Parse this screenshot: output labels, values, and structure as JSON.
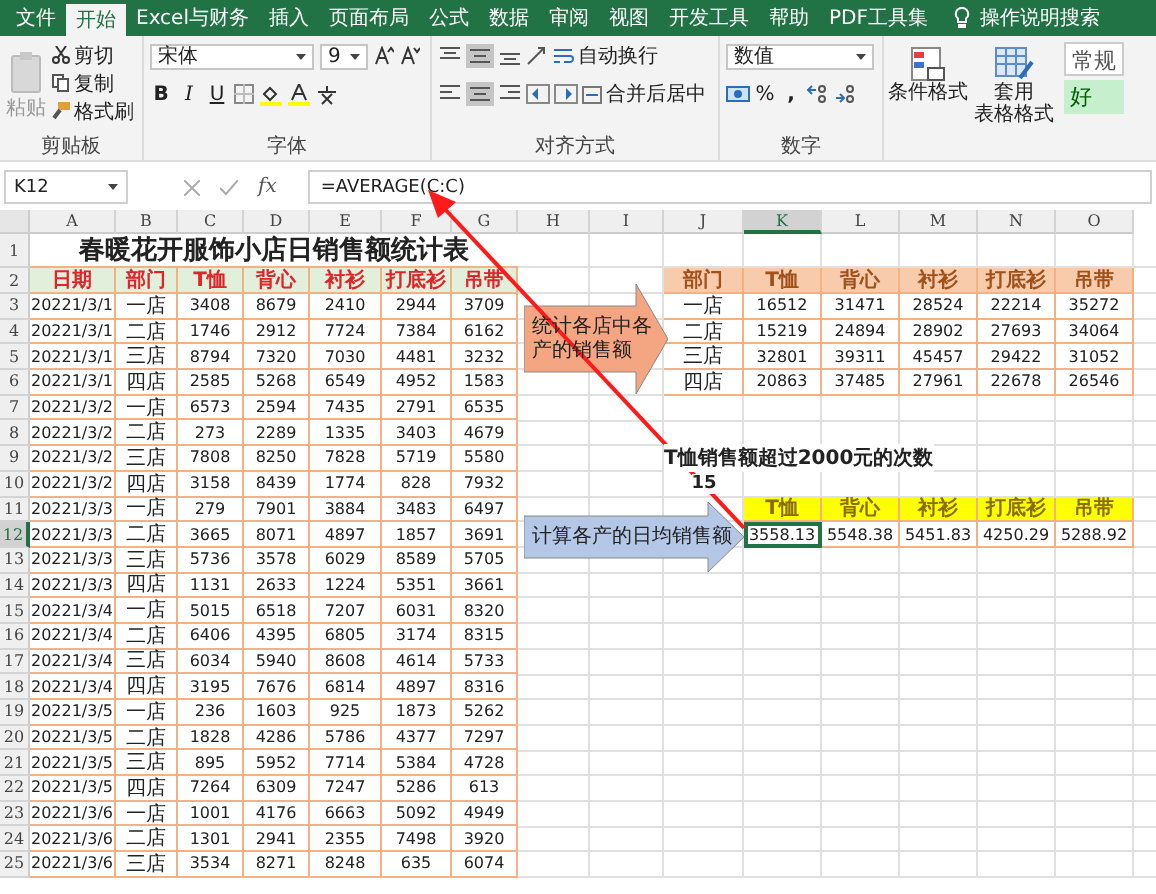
{
  "tabs": [
    {
      "label": "文件",
      "selected": false
    },
    {
      "label": "开始",
      "selected": true
    },
    {
      "label": "Excel与财务",
      "selected": false
    },
    {
      "label": "插入",
      "selected": false
    },
    {
      "label": "页面布局",
      "selected": false
    },
    {
      "label": "公式",
      "selected": false
    },
    {
      "label": "数据",
      "selected": false
    },
    {
      "label": "审阅",
      "selected": false
    },
    {
      "label": "视图",
      "selected": false
    },
    {
      "label": "开发工具",
      "selected": false
    },
    {
      "label": "帮助",
      "selected": false
    },
    {
      "label": "PDF工具集",
      "selected": false
    }
  ],
  "search": {
    "placeholder": "操作说明搜索"
  },
  "ribbon": {
    "clipboard": {
      "label": "剪贴板",
      "paste": "粘贴",
      "cut": "剪切",
      "copy": "复制",
      "format_painter": "格式刷"
    },
    "font": {
      "label": "字体",
      "font_name": "宋体",
      "font_size": "9",
      "bold": "B",
      "italic": "I",
      "underline": "U"
    },
    "alignment": {
      "label": "对齐方式",
      "wrap_text": "自动换行",
      "merge_center": "合并后居中"
    },
    "number": {
      "label": "数字",
      "format": "数值",
      "percent": "%",
      "comma": ","
    },
    "styles": {
      "conditional_format": "条件格式",
      "table_format_1": "套用",
      "table_format_2": "表格格式",
      "style_normal": "常规",
      "style_good": "好"
    }
  },
  "formula_bar": {
    "name_box": "K12",
    "fx": "fx",
    "formula": "=AVERAGE(C:C)"
  },
  "sheet": {
    "columns": [
      {
        "label": "A",
        "selected": false
      },
      {
        "label": "B",
        "selected": false
      },
      {
        "label": "C",
        "selected": false
      },
      {
        "label": "D",
        "selected": false
      },
      {
        "label": "E",
        "selected": false
      },
      {
        "label": "F",
        "selected": false
      },
      {
        "label": "G",
        "selected": false
      },
      {
        "label": "H",
        "selected": false
      },
      {
        "label": "I",
        "selected": false
      },
      {
        "label": "J",
        "selected": false
      },
      {
        "label": "K",
        "selected": true
      },
      {
        "label": "L",
        "selected": false
      },
      {
        "label": "M",
        "selected": false
      },
      {
        "label": "N",
        "selected": false
      },
      {
        "label": "O",
        "selected": false
      }
    ],
    "rows": [
      {
        "label": "1",
        "selected": false
      },
      {
        "label": "2",
        "selected": false
      },
      {
        "label": "3",
        "selected": false
      },
      {
        "label": "4",
        "selected": false
      },
      {
        "label": "5",
        "selected": false
      },
      {
        "label": "6",
        "selected": false
      },
      {
        "label": "7",
        "selected": false
      },
      {
        "label": "8",
        "selected": false
      },
      {
        "label": "9",
        "selected": false
      },
      {
        "label": "10",
        "selected": false
      },
      {
        "label": "11",
        "selected": false
      },
      {
        "label": "12",
        "selected": true
      },
      {
        "label": "13",
        "selected": false
      },
      {
        "label": "14",
        "selected": false
      },
      {
        "label": "15",
        "selected": false
      },
      {
        "label": "16",
        "selected": false
      },
      {
        "label": "17",
        "selected": false
      },
      {
        "label": "18",
        "selected": false
      },
      {
        "label": "19",
        "selected": false
      },
      {
        "label": "20",
        "selected": false
      },
      {
        "label": "21",
        "selected": false
      },
      {
        "label": "22",
        "selected": false
      },
      {
        "label": "23",
        "selected": false
      },
      {
        "label": "24",
        "selected": false
      },
      {
        "label": "25",
        "selected": false
      }
    ]
  },
  "sales": {
    "title": "春暖花开服饰小店日销售额统计表",
    "headers": [
      "日期",
      "部门",
      "T恤",
      "背心",
      "衬衫",
      "打底衫",
      "吊带"
    ],
    "rows": [
      [
        "20221/3/1",
        "一店",
        "3408",
        "8679",
        "2410",
        "2944",
        "3709"
      ],
      [
        "20221/3/1",
        "二店",
        "1746",
        "2912",
        "7724",
        "7384",
        "6162"
      ],
      [
        "20221/3/1",
        "三店",
        "8794",
        "7320",
        "7030",
        "4481",
        "3232"
      ],
      [
        "20221/3/1",
        "四店",
        "2585",
        "5268",
        "6549",
        "4952",
        "1583"
      ],
      [
        "20221/3/2",
        "一店",
        "6573",
        "2594",
        "7435",
        "2791",
        "6535"
      ],
      [
        "20221/3/2",
        "二店",
        "273",
        "2289",
        "1335",
        "3403",
        "4679"
      ],
      [
        "20221/3/2",
        "三店",
        "7808",
        "8250",
        "7828",
        "5719",
        "5580"
      ],
      [
        "20221/3/2",
        "四店",
        "3158",
        "8439",
        "1774",
        "828",
        "7932"
      ],
      [
        "20221/3/3",
        "一店",
        "279",
        "7901",
        "3884",
        "3483",
        "6497"
      ],
      [
        "20221/3/3",
        "二店",
        "3665",
        "8071",
        "4897",
        "1857",
        "3691"
      ],
      [
        "20221/3/3",
        "三店",
        "5736",
        "3578",
        "6029",
        "8589",
        "5705"
      ],
      [
        "20221/3/3",
        "四店",
        "1131",
        "2633",
        "1224",
        "5351",
        "3661"
      ],
      [
        "20221/3/4",
        "一店",
        "5015",
        "6518",
        "7207",
        "6031",
        "8320"
      ],
      [
        "20221/3/4",
        "二店",
        "6406",
        "4395",
        "6805",
        "3174",
        "8315"
      ],
      [
        "20221/3/4",
        "三店",
        "6034",
        "5940",
        "8608",
        "4614",
        "5733"
      ],
      [
        "20221/3/4",
        "四店",
        "3195",
        "7676",
        "6814",
        "4897",
        "8316"
      ],
      [
        "20221/3/5",
        "一店",
        "236",
        "1603",
        "925",
        "1873",
        "5262"
      ],
      [
        "20221/3/5",
        "二店",
        "1828",
        "4286",
        "5786",
        "4377",
        "7297"
      ],
      [
        "20221/3/5",
        "三店",
        "895",
        "5952",
        "7714",
        "5384",
        "4728"
      ],
      [
        "20221/3/5",
        "四店",
        "7264",
        "6309",
        "7247",
        "5286",
        "613"
      ],
      [
        "20221/3/6",
        "一店",
        "1001",
        "4176",
        "6663",
        "5092",
        "4949"
      ],
      [
        "20221/3/6",
        "二店",
        "1301",
        "2941",
        "2355",
        "7498",
        "3920"
      ],
      [
        "20221/3/6",
        "三店",
        "3534",
        "8271",
        "8248",
        "635",
        "6074"
      ]
    ]
  },
  "summary": {
    "headers": [
      "部门",
      "T恤",
      "背心",
      "衬衫",
      "打底衫",
      "吊带"
    ],
    "rows": [
      [
        "一店",
        "16512",
        "31471",
        "28524",
        "22214",
        "35272"
      ],
      [
        "二店",
        "15219",
        "24894",
        "28902",
        "27693",
        "34064"
      ],
      [
        "三店",
        "32801",
        "39311",
        "45457",
        "29422",
        "31052"
      ],
      [
        "四店",
        "20863",
        "37485",
        "27961",
        "22678",
        "26546"
      ]
    ]
  },
  "count": {
    "label": "T恤销售额超过2000元的次数",
    "value": "15"
  },
  "average": {
    "headers": [
      "T恤",
      "背心",
      "衬衫",
      "打底衫",
      "吊带"
    ],
    "values": [
      {
        "text": "3558.13",
        "selected": true
      },
      {
        "text": "5548.38",
        "selected": false
      },
      {
        "text": "5451.83",
        "selected": false
      },
      {
        "text": "4250.29",
        "selected": false
      },
      {
        "text": "5288.92",
        "selected": false
      }
    ]
  },
  "callouts": [
    {
      "text": "统计各店中各产的销售额",
      "color": "#f4a582"
    },
    {
      "text": "计算各产的日均销售额",
      "color": "#b4c7e7"
    }
  ]
}
